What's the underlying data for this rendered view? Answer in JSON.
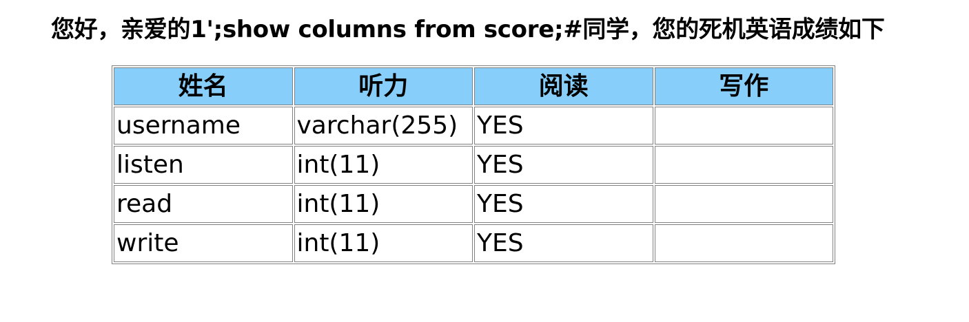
{
  "page": {
    "heading": "您好，亲爱的1';show columns from score;#同学，您的死机英语成绩如下"
  },
  "table": {
    "header_bg": "#87cefa",
    "columns": [
      "姓名",
      "听力",
      "阅读",
      "写作"
    ],
    "rows": [
      [
        "username",
        "varchar(255)",
        "YES",
        ""
      ],
      [
        "listen",
        "int(11)",
        "YES",
        ""
      ],
      [
        "read",
        "int(11)",
        "YES",
        ""
      ],
      [
        "write",
        "int(11)",
        "YES",
        ""
      ]
    ]
  }
}
